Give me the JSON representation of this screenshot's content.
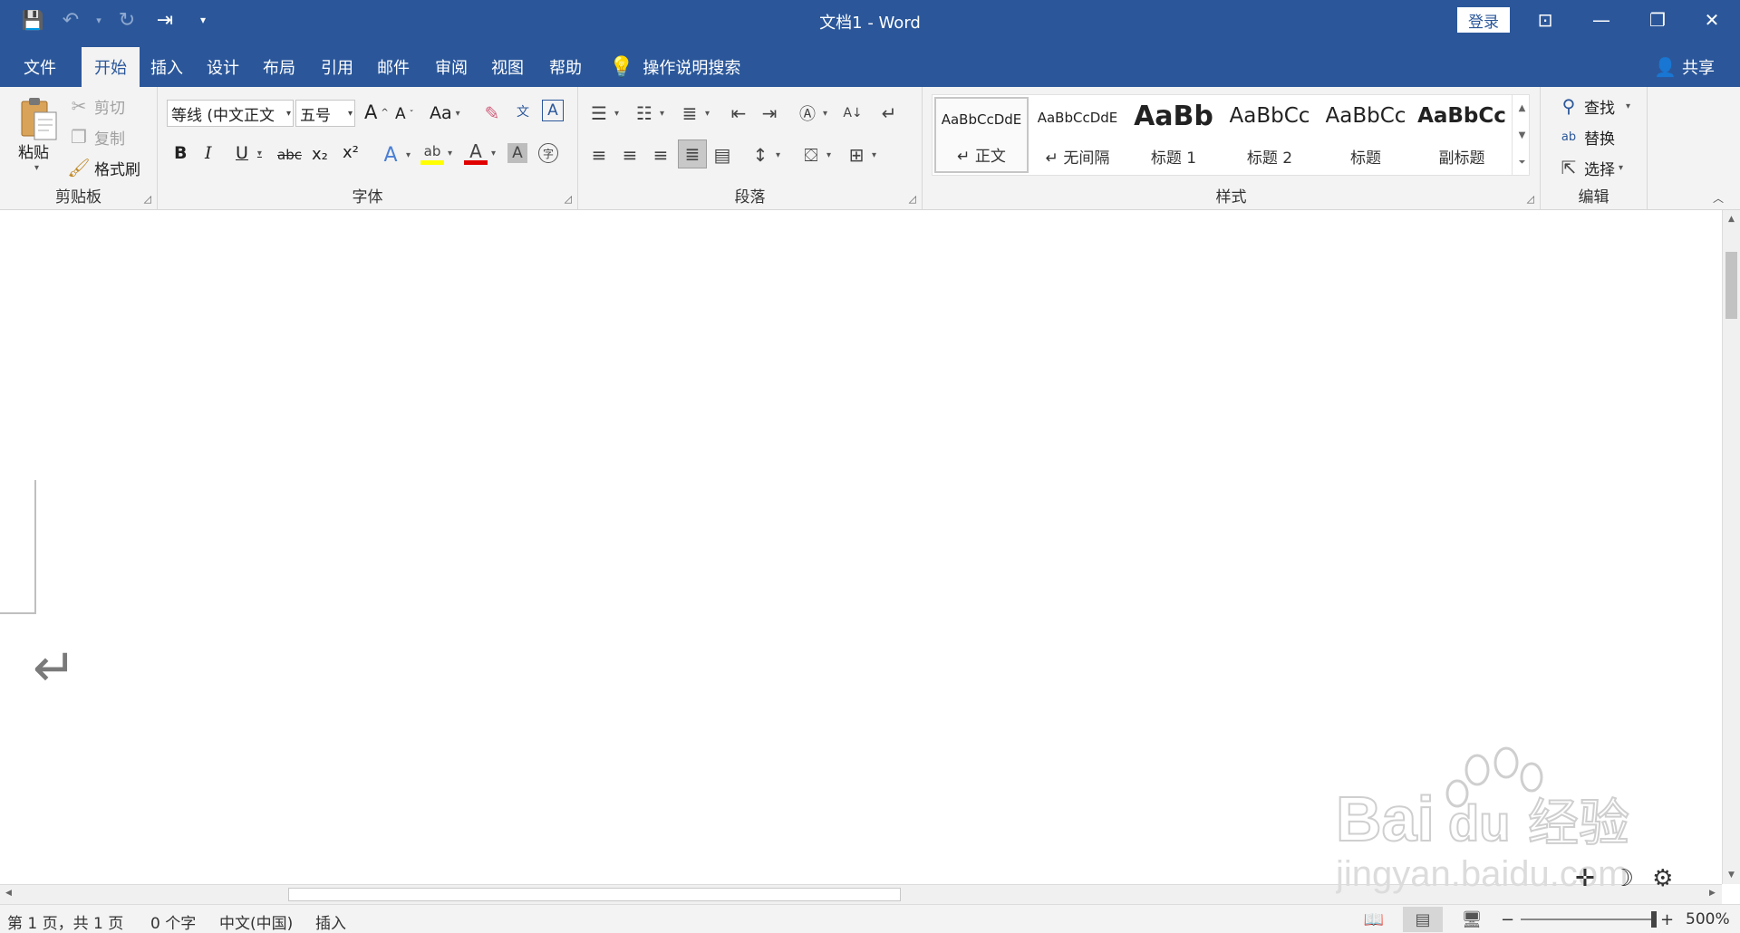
{
  "window": {
    "title": "文档1  -  Word",
    "login_label": "登录",
    "controls": {
      "ribbon_display": "⊡",
      "minimize": "—",
      "restore": "❐",
      "close": "✕"
    }
  },
  "qat": {
    "save": "💾",
    "undo": "↶",
    "redo": "↻",
    "touch": "⇥",
    "customize": "▾"
  },
  "tabs": [
    "文件",
    "开始",
    "插入",
    "设计",
    "布局",
    "引用",
    "邮件",
    "审阅",
    "视图",
    "帮助"
  ],
  "active_tab": "开始",
  "tell_me": "操作说明搜索",
  "share": "共享",
  "clipboard": {
    "paste": "粘贴",
    "cut": "剪切",
    "copy": "复制",
    "format_painter": "格式刷",
    "label": "剪贴板"
  },
  "font": {
    "font_name": "等线 (中文正文",
    "font_size": "五号",
    "grow": "A",
    "shrink": "A",
    "change_case": "Aa",
    "bold": "B",
    "italic": "I",
    "underline": "U",
    "strike": "abc",
    "subscript": "x₂",
    "superscript": "x²",
    "label": "字体"
  },
  "paragraph": {
    "label": "段落"
  },
  "styles": {
    "items": [
      {
        "sample": "AaBbCcDdE",
        "name": "↵ 正文"
      },
      {
        "sample": "AaBbCcDdE",
        "name": "↵ 无间隔"
      },
      {
        "sample": "AaBb",
        "name": "标题 1"
      },
      {
        "sample": "AaBbCc",
        "name": "标题 2"
      },
      {
        "sample": "AaBbCc",
        "name": "标题"
      },
      {
        "sample": "AaBbCc",
        "name": "副标题"
      }
    ],
    "label": "样式"
  },
  "editing": {
    "find": "查找",
    "replace": "替换",
    "select": "选择",
    "label": "编辑"
  },
  "document": {
    "paragraph_mark": "↵"
  },
  "watermark": {
    "brand": "Bai",
    "brand2": "du",
    "cn": "经验",
    "url": "jingyan.baidu.com"
  },
  "status": {
    "page": "第 1 页，共 1 页",
    "words": "0 个字",
    "language": "中文(中国)",
    "mode": "插入",
    "zoom": "500%",
    "zoom_minus": "−",
    "zoom_plus": "+"
  }
}
